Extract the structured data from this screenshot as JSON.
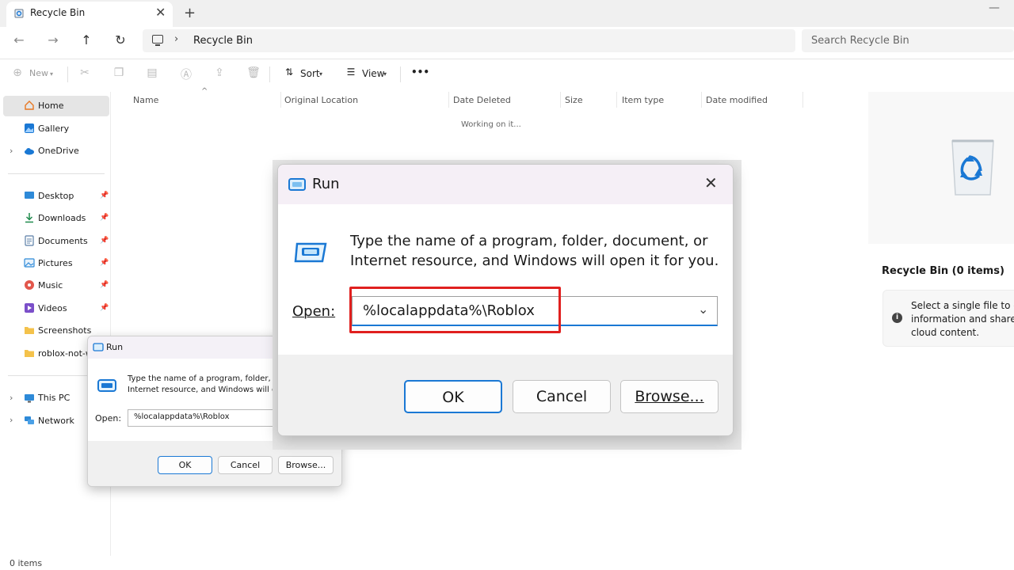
{
  "window": {
    "tab_title": "Recycle Bin",
    "tab_close": "✕",
    "new_tab": "+",
    "minimize": "—"
  },
  "address": {
    "chevron": "›",
    "path": "Recycle Bin",
    "search_placeholder": "Search Recycle Bin"
  },
  "nav_icons": [
    "arrow-left-icon",
    "arrow-right-icon",
    "arrow-up-icon",
    "refresh-icon"
  ],
  "toolbar": {
    "new_label": "New",
    "sort_label": "Sort",
    "view_label": "View",
    "more_label": "•••"
  },
  "sidebar": {
    "items": [
      {
        "label": "Home",
        "icon": "home-icon"
      },
      {
        "label": "Gallery",
        "icon": "gallery-icon"
      },
      {
        "label": "OneDrive",
        "icon": "cloud-icon"
      },
      {
        "label": "Desktop",
        "icon": "desktop-icon"
      },
      {
        "label": "Downloads",
        "icon": "download-icon"
      },
      {
        "label": "Documents",
        "icon": "document-icon"
      },
      {
        "label": "Pictures",
        "icon": "picture-icon"
      },
      {
        "label": "Music",
        "icon": "music-icon"
      },
      {
        "label": "Videos",
        "icon": "video-icon"
      },
      {
        "label": "Screenshots",
        "icon": "folder-icon"
      },
      {
        "label": "roblox-not-w",
        "icon": "folder-icon"
      },
      {
        "label": "This PC",
        "icon": "pc-icon"
      },
      {
        "label": "Network",
        "icon": "network-icon"
      }
    ]
  },
  "columns": {
    "headers": [
      "Name",
      "Original Location",
      "Date Deleted",
      "Size",
      "Item type",
      "Date modified"
    ],
    "sort_indicator": "^"
  },
  "content": {
    "working_text": "Working on it..."
  },
  "details": {
    "title": "Recycle Bin (0 items)",
    "info_icon": "i",
    "info_lines": [
      "Select a single file to ge",
      "information and share y",
      "cloud content."
    ]
  },
  "status_bar": {
    "items_count": "0 items"
  },
  "run_small": {
    "title": "Run",
    "description_line1": "Type the name of a program, folder, do",
    "description_line2": "Internet resource, and Windows will ope",
    "open_label": "Open:",
    "open_value": "%localappdata%\\Roblox",
    "ok": "OK",
    "cancel": "Cancel",
    "browse": "Browse..."
  },
  "run_large": {
    "title": "Run",
    "close": "✕",
    "description_line1": "Type the name of a program, folder, document, or",
    "description_line2": "Internet resource, and Windows will open it for you.",
    "open_label": "Open:",
    "open_value": "%localappdata%\\Roblox",
    "ok": "OK",
    "cancel": "Cancel",
    "browse": "Browse..."
  },
  "colors": {
    "accent": "#0067c0",
    "highlight": "#e0201f",
    "recycle_blue": "#1a78d4"
  }
}
